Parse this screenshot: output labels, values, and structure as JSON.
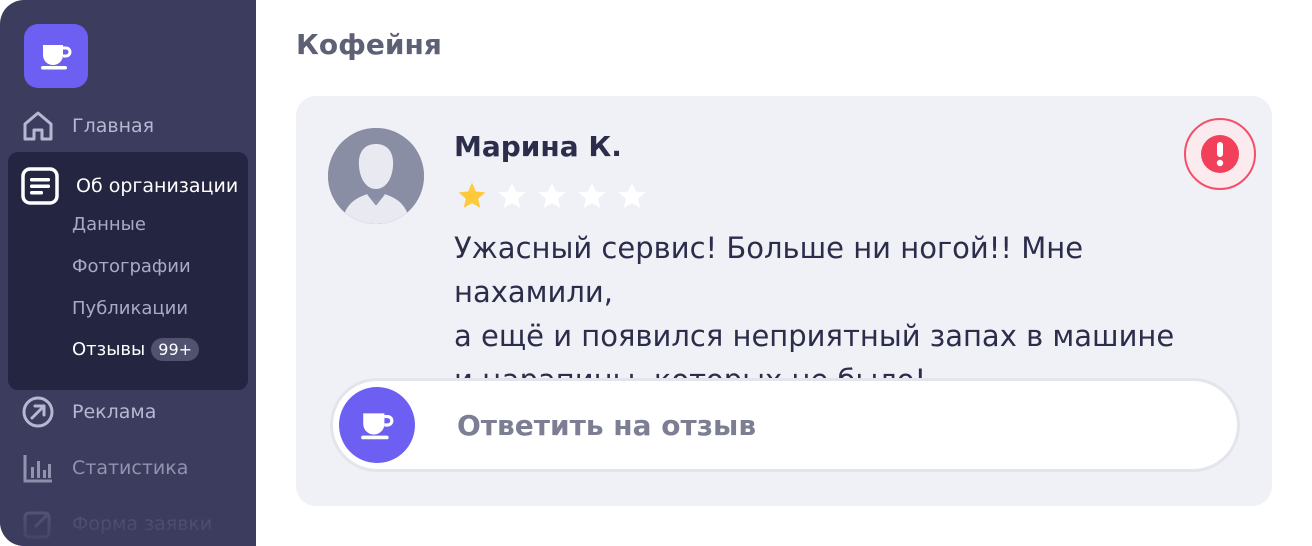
{
  "sidebar": {
    "logo_icon": "coffee-cup-icon",
    "items": [
      {
        "label": "Главная",
        "icon": "home-icon"
      },
      {
        "label": "Об организации",
        "icon": "document-icon"
      },
      {
        "label": "Реклама",
        "icon": "arrow-up-right-circle-icon"
      },
      {
        "label": "Статистика",
        "icon": "bar-chart-icon"
      },
      {
        "label": "Форма заявки",
        "icon": "edit-icon"
      }
    ],
    "subitems": [
      {
        "label": "Данные"
      },
      {
        "label": "Фотографии"
      },
      {
        "label": "Публикации"
      },
      {
        "label": "Отзывы",
        "badge": "99+"
      }
    ],
    "colors": {
      "background": "#3b3c5e",
      "active": "#232541",
      "accent": "#6c5ff2"
    }
  },
  "main": {
    "title": "Кофейня",
    "review": {
      "author": "Марина К.",
      "rating": 1,
      "max_rating": 5,
      "text_lines": [
        "Ужасный сервис! Больше ни ногой!! Мне нахамили,",
        "а ещё и появился неприятный запах в машине",
        "и царапины, которых не было!"
      ],
      "alert_icon": "exclamation-icon",
      "reply_placeholder": "Ответить на отзыв"
    },
    "colors": {
      "star_filled": "#ffc93c",
      "star_empty": "#ffffff",
      "alert": "#f23f5a"
    }
  }
}
